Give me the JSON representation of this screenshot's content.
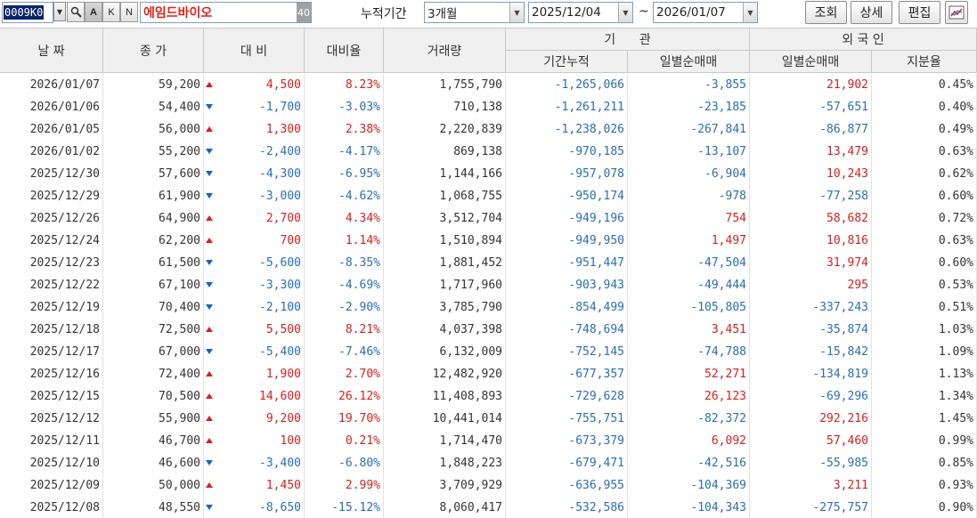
{
  "toolbar": {
    "stock_code": "0009K0",
    "stock_name": "에임드바이오",
    "name_count": "40",
    "btn_a": "A",
    "btn_k": "K",
    "btn_n": "N",
    "period_label": "누적기간",
    "period_value": "3개월",
    "date_from": "2025/12/04",
    "date_sep": "~",
    "date_to": "2026/01/07",
    "query_button": "조회",
    "detail_button": "상세",
    "edit_button": "편집"
  },
  "header": {
    "date": "날 짜",
    "close": "종 가",
    "change": "대 비",
    "change_rate": "대비율",
    "volume": "거래량",
    "institution_group": "기      관",
    "inst_cumulative": "기간누적",
    "inst_daily_net": "일별순매매",
    "foreign_group": "외 국 인",
    "foreign_daily_net": "일별순매매",
    "foreign_ratio": "지분율"
  },
  "colors": {
    "up": "#d42020",
    "down": "#2a6db5",
    "header_bg": "#f0f0f0"
  },
  "rows": [
    {
      "date": "2026/01/07",
      "close": "59,200",
      "dir": "up",
      "change": "4,500",
      "rate": "8.23%",
      "volume": "1,755,790",
      "inst_cum": "-1,265,066",
      "inst_net": "-3,855",
      "for_net": "21,902",
      "for_ratio": "0.45%"
    },
    {
      "date": "2026/01/06",
      "close": "54,400",
      "dir": "dn",
      "change": "-1,700",
      "rate": "-3.03%",
      "volume": "710,138",
      "inst_cum": "-1,261,211",
      "inst_net": "-23,185",
      "for_net": "-57,651",
      "for_ratio": "0.40%"
    },
    {
      "date": "2026/01/05",
      "close": "56,000",
      "dir": "up",
      "change": "1,300",
      "rate": "2.38%",
      "volume": "2,220,839",
      "inst_cum": "-1,238,026",
      "inst_net": "-267,841",
      "for_net": "-86,877",
      "for_ratio": "0.49%"
    },
    {
      "date": "2026/01/02",
      "close": "55,200",
      "dir": "dn",
      "change": "-2,400",
      "rate": "-4.17%",
      "volume": "869,138",
      "inst_cum": "-970,185",
      "inst_net": "-13,107",
      "for_net": "13,479",
      "for_ratio": "0.63%"
    },
    {
      "date": "2025/12/30",
      "close": "57,600",
      "dir": "dn",
      "change": "-4,300",
      "rate": "-6.95%",
      "volume": "1,144,166",
      "inst_cum": "-957,078",
      "inst_net": "-6,904",
      "for_net": "10,243",
      "for_ratio": "0.62%"
    },
    {
      "date": "2025/12/29",
      "close": "61,900",
      "dir": "dn",
      "change": "-3,000",
      "rate": "-4.62%",
      "volume": "1,068,755",
      "inst_cum": "-950,174",
      "inst_net": "-978",
      "for_net": "-77,258",
      "for_ratio": "0.60%"
    },
    {
      "date": "2025/12/26",
      "close": "64,900",
      "dir": "up",
      "change": "2,700",
      "rate": "4.34%",
      "volume": "3,512,704",
      "inst_cum": "-949,196",
      "inst_net": "754",
      "for_net": "58,682",
      "for_ratio": "0.72%"
    },
    {
      "date": "2025/12/24",
      "close": "62,200",
      "dir": "up",
      "change": "700",
      "rate": "1.14%",
      "volume": "1,510,894",
      "inst_cum": "-949,950",
      "inst_net": "1,497",
      "for_net": "10,816",
      "for_ratio": "0.63%"
    },
    {
      "date": "2025/12/23",
      "close": "61,500",
      "dir": "dn",
      "change": "-5,600",
      "rate": "-8.35%",
      "volume": "1,881,452",
      "inst_cum": "-951,447",
      "inst_net": "-47,504",
      "for_net": "31,974",
      "for_ratio": "0.60%"
    },
    {
      "date": "2025/12/22",
      "close": "67,100",
      "dir": "dn",
      "change": "-3,300",
      "rate": "-4.69%",
      "volume": "1,717,960",
      "inst_cum": "-903,943",
      "inst_net": "-49,444",
      "for_net": "295",
      "for_ratio": "0.53%"
    },
    {
      "date": "2025/12/19",
      "close": "70,400",
      "dir": "dn",
      "change": "-2,100",
      "rate": "-2.90%",
      "volume": "3,785,790",
      "inst_cum": "-854,499",
      "inst_net": "-105,805",
      "for_net": "-337,243",
      "for_ratio": "0.51%"
    },
    {
      "date": "2025/12/18",
      "close": "72,500",
      "dir": "up",
      "change": "5,500",
      "rate": "8.21%",
      "volume": "4,037,398",
      "inst_cum": "-748,694",
      "inst_net": "3,451",
      "for_net": "-35,874",
      "for_ratio": "1.03%"
    },
    {
      "date": "2025/12/17",
      "close": "67,000",
      "dir": "dn",
      "change": "-5,400",
      "rate": "-7.46%",
      "volume": "6,132,009",
      "inst_cum": "-752,145",
      "inst_net": "-74,788",
      "for_net": "-15,842",
      "for_ratio": "1.09%"
    },
    {
      "date": "2025/12/16",
      "close": "72,400",
      "dir": "up",
      "change": "1,900",
      "rate": "2.70%",
      "volume": "12,482,920",
      "inst_cum": "-677,357",
      "inst_net": "52,271",
      "for_net": "-134,819",
      "for_ratio": "1.13%"
    },
    {
      "date": "2025/12/15",
      "close": "70,500",
      "dir": "up",
      "change": "14,600",
      "rate": "26.12%",
      "volume": "11,408,893",
      "inst_cum": "-729,628",
      "inst_net": "26,123",
      "for_net": "-69,296",
      "for_ratio": "1.34%"
    },
    {
      "date": "2025/12/12",
      "close": "55,900",
      "dir": "up",
      "change": "9,200",
      "rate": "19.70%",
      "volume": "10,441,014",
      "inst_cum": "-755,751",
      "inst_net": "-82,372",
      "for_net": "292,216",
      "for_ratio": "1.45%"
    },
    {
      "date": "2025/12/11",
      "close": "46,700",
      "dir": "up",
      "change": "100",
      "rate": "0.21%",
      "volume": "1,714,470",
      "inst_cum": "-673,379",
      "inst_net": "6,092",
      "for_net": "57,460",
      "for_ratio": "0.99%"
    },
    {
      "date": "2025/12/10",
      "close": "46,600",
      "dir": "dn",
      "change": "-3,400",
      "rate": "-6.80%",
      "volume": "1,848,223",
      "inst_cum": "-679,471",
      "inst_net": "-42,516",
      "for_net": "-55,985",
      "for_ratio": "0.85%"
    },
    {
      "date": "2025/12/09",
      "close": "50,000",
      "dir": "up",
      "change": "1,450",
      "rate": "2.99%",
      "volume": "3,709,929",
      "inst_cum": "-636,955",
      "inst_net": "-104,369",
      "for_net": "3,211",
      "for_ratio": "0.93%"
    },
    {
      "date": "2025/12/08",
      "close": "48,550",
      "dir": "dn",
      "change": "-8,650",
      "rate": "-15.12%",
      "volume": "8,060,417",
      "inst_cum": "-532,586",
      "inst_net": "-104,343",
      "for_net": "-275,757",
      "for_ratio": "0.90%"
    }
  ]
}
